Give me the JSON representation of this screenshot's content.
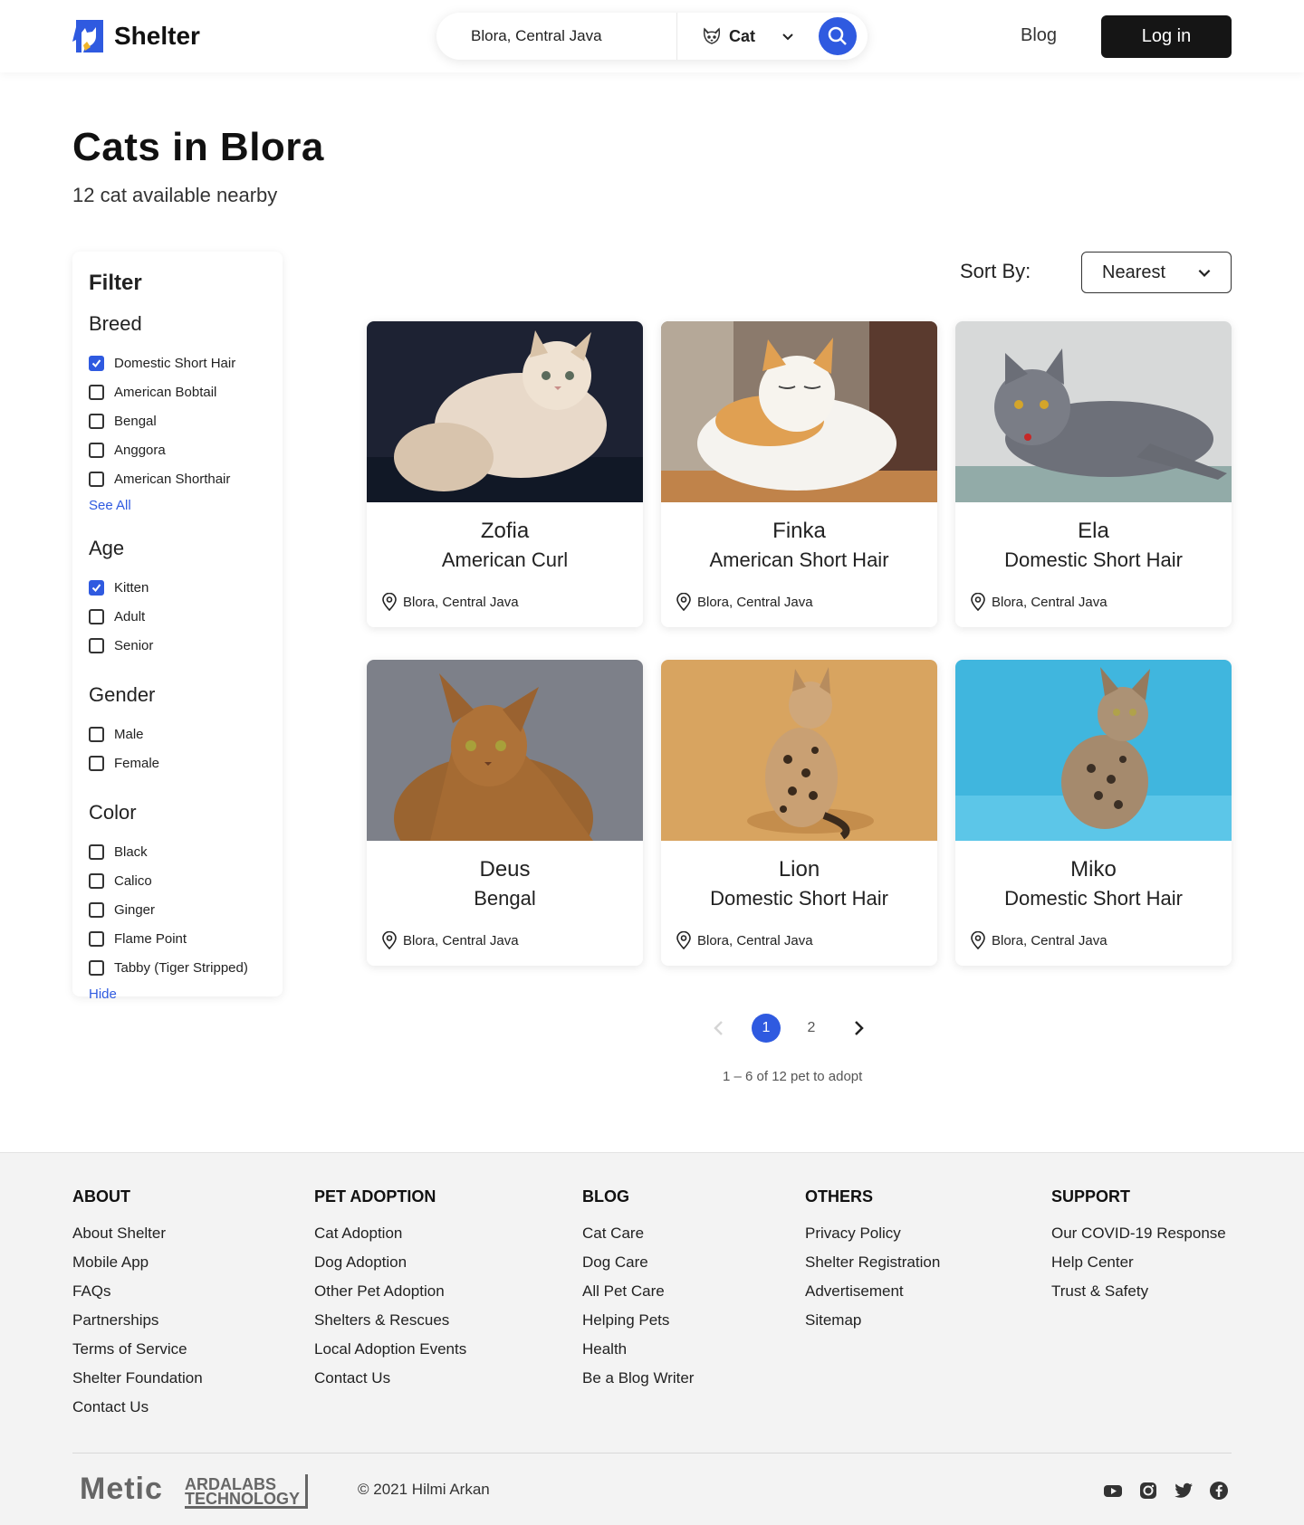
{
  "header": {
    "logo_text": "Shelter",
    "search_location": "Blora, Central Java",
    "pet_type": "Cat",
    "nav_blog": "Blog",
    "login": "Log in"
  },
  "page": {
    "title": "Cats in Blora",
    "subtitle": "12 cat available nearby"
  },
  "filter": {
    "title": "Filter",
    "groups": [
      {
        "title": "Breed",
        "items": [
          {
            "label": "Domestic Short Hair",
            "checked": true
          },
          {
            "label": "American Bobtail",
            "checked": false
          },
          {
            "label": "Bengal",
            "checked": false
          },
          {
            "label": "Anggora",
            "checked": false
          },
          {
            "label": "American Shorthair",
            "checked": false
          }
        ],
        "link": "See All"
      },
      {
        "title": "Age",
        "items": [
          {
            "label": "Kitten",
            "checked": true
          },
          {
            "label": "Adult",
            "checked": false
          },
          {
            "label": "Senior",
            "checked": false
          }
        ]
      },
      {
        "title": "Gender",
        "items": [
          {
            "label": "Male",
            "checked": false
          },
          {
            "label": "Female",
            "checked": false
          }
        ]
      },
      {
        "title": "Color",
        "items": [
          {
            "label": "Black",
            "checked": false
          },
          {
            "label": "Calico",
            "checked": false
          },
          {
            "label": "Ginger",
            "checked": false
          },
          {
            "label": "Flame Point",
            "checked": false
          },
          {
            "label": "Tabby (Tiger Stripped)",
            "checked": false
          }
        ],
        "link": "Hide"
      }
    ]
  },
  "sort": {
    "label": "Sort By:",
    "selected": "Nearest"
  },
  "pets": [
    {
      "name": "Zofia",
      "breed": "American Curl",
      "location": "Blora, Central Java"
    },
    {
      "name": "Finka",
      "breed": "American Short Hair",
      "location": "Blora, Central Java"
    },
    {
      "name": "Ela",
      "breed": "Domestic Short Hair",
      "location": "Blora, Central Java"
    },
    {
      "name": "Deus",
      "breed": "Bengal",
      "location": "Blora, Central Java"
    },
    {
      "name": "Lion",
      "breed": "Domestic Short Hair",
      "location": "Blora, Central Java"
    },
    {
      "name": "Miko",
      "breed": "Domestic Short Hair",
      "location": "Blora, Central Java"
    }
  ],
  "pagination": {
    "pages": [
      "1",
      "2"
    ],
    "current": "1",
    "info": "1 – 6 of 12 pet to adopt"
  },
  "footer": {
    "columns": [
      {
        "title": "ABOUT",
        "links": [
          "About Shelter",
          "Mobile App",
          "FAQs",
          "Partnerships",
          "Terms of Service",
          "Shelter Foundation",
          "Contact Us"
        ]
      },
      {
        "title": "PET ADOPTION",
        "links": [
          "Cat Adoption",
          "Dog Adoption",
          "Other Pet Adoption",
          "Shelters & Rescues",
          "Local Adoption Events",
          "Contact Us"
        ]
      },
      {
        "title": "BLOG",
        "links": [
          "Cat Care",
          "Dog Care",
          "All Pet Care",
          "Helping Pets",
          "Health",
          "Be a Blog Writer"
        ]
      },
      {
        "title": "OTHERS",
        "links": [
          "Privacy Policy",
          "Shelter Registration",
          "Advertisement",
          "Sitemap"
        ]
      },
      {
        "title": "SUPPORT",
        "links": [
          "Our COVID-19 Response",
          "Help Center",
          "Trust & Safety"
        ]
      }
    ],
    "brand_metic": "Metic",
    "brand_ardalabs_line1": "ARDALABS",
    "brand_ardalabs_line2": "TECHNOLOGY",
    "copyright": "© 2021 Hilmi Arkan",
    "social_icons": [
      "youtube-icon",
      "instagram-icon",
      "twitter-icon",
      "facebook-icon"
    ]
  },
  "colors": {
    "accent": "#2f5ae0",
    "dark_button": "#151515",
    "footer_bg": "#f3f3f3"
  }
}
